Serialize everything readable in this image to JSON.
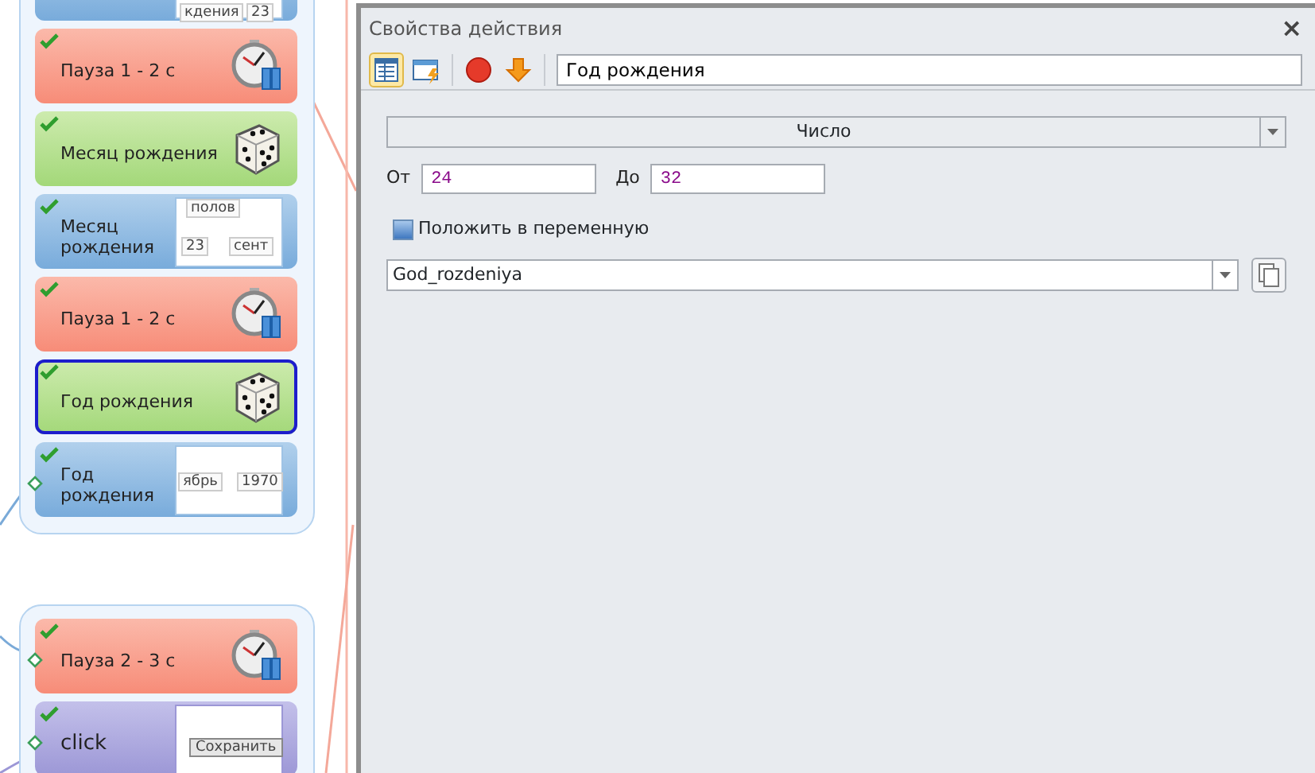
{
  "canvas": {
    "groups": [
      {
        "blocks": [
          {
            "kind": "screen",
            "selected": false,
            "thumb": [
              "кдения",
              "23"
            ]
          },
          {
            "kind": "pause",
            "label": "Пауза 1 - 2 с",
            "checked": true,
            "selected": false,
            "port": false
          },
          {
            "kind": "random",
            "label": "Месяц рождения",
            "checked": true,
            "selected": false,
            "port": false
          },
          {
            "kind": "screen",
            "label": "Месяц рождения",
            "checked": true,
            "selected": false,
            "port": false,
            "thumb": [
              "полов",
              "23",
              "сент"
            ]
          },
          {
            "kind": "pause",
            "label": "Пауза 1 - 2 с",
            "checked": true,
            "selected": false,
            "port": false
          },
          {
            "kind": "random",
            "label": "Год рождения",
            "checked": true,
            "selected": true,
            "port": false
          },
          {
            "kind": "screen",
            "label": "Год рождения",
            "checked": true,
            "selected": false,
            "port": true,
            "thumb": [
              "ябрь",
              "1970"
            ]
          }
        ]
      },
      {
        "blocks": [
          {
            "kind": "pause",
            "label": "Пауза 2 - 3 с",
            "checked": true,
            "selected": false,
            "port": true
          },
          {
            "kind": "click",
            "label": "click",
            "checked": true,
            "selected": false,
            "port": true,
            "thumb": [
              "Сохранить"
            ]
          }
        ]
      }
    ]
  },
  "dialog": {
    "title": "Свойства действия",
    "close": "×",
    "toolbar": {
      "tools": [
        {
          "kind": "table",
          "selected": true
        },
        {
          "kind": "window",
          "selected": false
        },
        {
          "kind": "stop",
          "selected": false
        },
        {
          "kind": "down",
          "selected": false
        }
      ],
      "name": "Год рождения"
    },
    "type": "Число",
    "from_label": "От",
    "from": "24",
    "to_label": "До",
    "to": "32",
    "save_to_variable": {
      "label": "Положить в переменную",
      "checked": false
    },
    "variable": "God_rozdeniya"
  }
}
